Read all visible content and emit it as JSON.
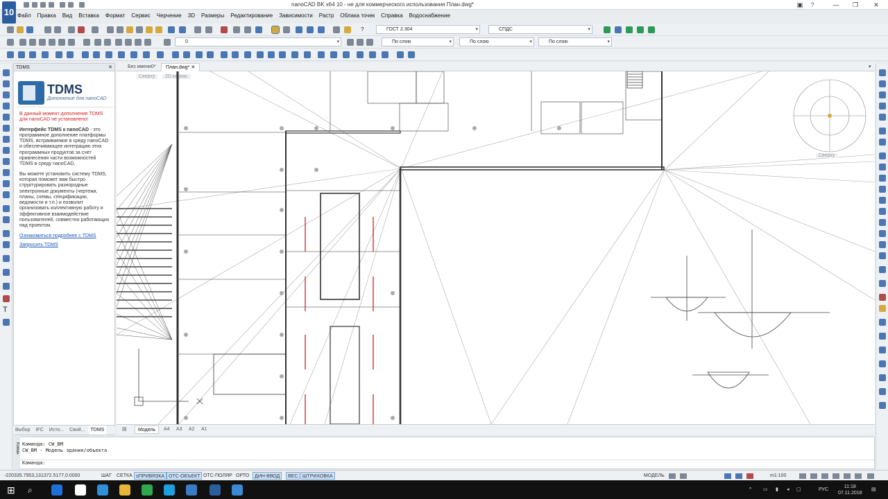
{
  "window": {
    "title": "nanoCAD BK x64 10 - не для коммерческого использования План.dwg*",
    "logo_text": "10"
  },
  "menu": [
    "Файл",
    "Правка",
    "Вид",
    "Вставка",
    "Формат",
    "Сервис",
    "Черчение",
    "3D",
    "Размеры",
    "Редактирование",
    "Зависимости",
    "Растр",
    "Облака точек",
    "Справка",
    "Водоснабжение"
  ],
  "toolbar": {
    "dimstyle": "ГОСТ 2.304",
    "textstyle": "СПДС",
    "layer": "0",
    "color": "По слою",
    "linetype": "По слою",
    "lineweight": "По слою",
    "help": "?"
  },
  "panel": {
    "title": "TDMS",
    "brand": "TDMS",
    "brand_sub": "Дополнение для nanoCAD",
    "warning": "В данный момент дополнение TDMS для nanoCAD не установлено!",
    "intro_bold": "Интерфейс TDMS к nanoCAD",
    "intro_rest": " - это программное дополнение платформы TDMS, встраиваемое в среду nanoCAD и обеспечивающее интеграцию этих программных продуктов за счет привнесения части возможностей TDMS в среду nanoCAD.",
    "para2": "Вы можете установить систему TDMS, которая поможет вам быстро структурировать разнородные электронные документы (чертежи, планы, схемы, спецификации, ведомости и т.п.) и позволит организовать коллективную работу и эффективное взаимодействие пользователей, совместно работающих над проектом.",
    "link1": "Ознакомиться подробнее с TDMS",
    "link2": "Запросить TDMS",
    "tabs": [
      "Выбор",
      "IFC",
      "Исто...",
      "Свой...",
      "TDMS"
    ]
  },
  "doc_tabs": [
    "Без имени0*",
    "План.dwg*"
  ],
  "view": {
    "top_label": "Сверху",
    "mode_label": "2D каркас",
    "cube_label": "Сверху"
  },
  "layout_tabs": [
    "Модель",
    "А4",
    "А3",
    "А2",
    "А1"
  ],
  "command": {
    "lines": [
      "Команда: CW_BM",
      "CW_BM - Модель здания/объекта",
      "Команда:"
    ],
    "side": "Коман"
  },
  "status": {
    "coords": "-220335.7953,131372.5177,0.0000",
    "toggles": [
      {
        "label": "ШАГ",
        "on": false
      },
      {
        "label": "СЕТКА",
        "on": false
      },
      {
        "label": "оПРИВЯЗКА",
        "on": true
      },
      {
        "label": "ОТС-ОБЪЕКТ",
        "on": true
      },
      {
        "label": "ОТС-ПОЛЯР",
        "on": false
      },
      {
        "label": "ОРТО",
        "on": false
      },
      {
        "label": "ДИН-ВВОД",
        "on": true
      },
      {
        "label": "ВЕС",
        "on": true
      },
      {
        "label": "ШТРИХОВКА",
        "on": true
      }
    ],
    "model": "МОДЕЛЬ",
    "scale": "m1:100"
  },
  "taskbar": {
    "lang": "РУС",
    "time": "11:18",
    "date": "07.11.2018"
  },
  "colors": {
    "accent": "#2b5e9e",
    "canvas": "#ffffff",
    "wall": "#444444",
    "red_marks": "#cc3333"
  }
}
